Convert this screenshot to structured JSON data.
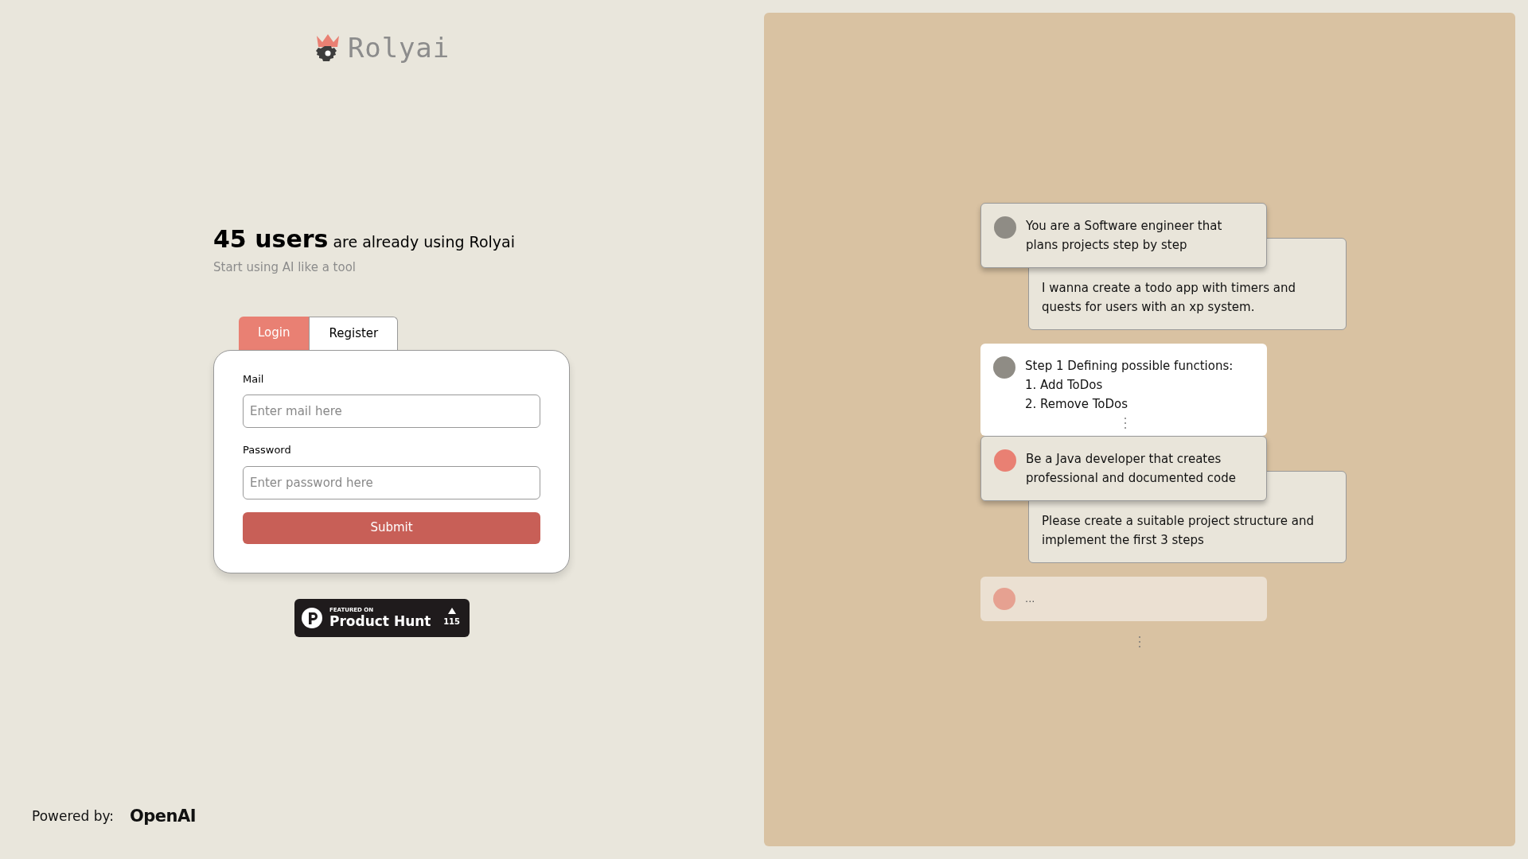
{
  "logo": {
    "text": "Rolyai"
  },
  "headline": {
    "count": "45 users",
    "rest": "are already using Rolyai",
    "subtitle": "Start using AI like a tool"
  },
  "tabs": [
    {
      "label": "Login",
      "selected": true
    },
    {
      "label": "Register",
      "selected": false
    }
  ],
  "form": {
    "fields": [
      {
        "label": "Mail",
        "placeholder": "Enter mail here"
      },
      {
        "label": "Password",
        "placeholder": "Enter password here"
      }
    ],
    "submit": "Submit"
  },
  "badge": {
    "small": "FEATURED ON",
    "name": "Product Hunt",
    "count": "115"
  },
  "footer": {
    "label": "Powered by:",
    "brand": "OpenAI"
  },
  "conversation": [
    {
      "kind": "system",
      "color": "#8f8c85",
      "lines": [
        "You are a Software engineer that plans projects step by step"
      ]
    },
    {
      "kind": "user",
      "lines": [
        "I wanna create a todo app with timers and quests for users with an xp system."
      ]
    },
    {
      "kind": "response",
      "color": "#8f8c85",
      "lines": [
        "Step 1 Defining possible functions:",
        "1. Add ToDos",
        "2. Remove ToDos"
      ]
    },
    {
      "kind": "system",
      "color": "#e98073",
      "lines": [
        "Be a Java developer that creates professional and documented code"
      ]
    },
    {
      "kind": "user",
      "lines": [
        "Please create a suitable project structure and implement the first 3 steps"
      ]
    },
    {
      "kind": "pending",
      "color": "#e6a191",
      "lines": [
        "..."
      ]
    }
  ]
}
